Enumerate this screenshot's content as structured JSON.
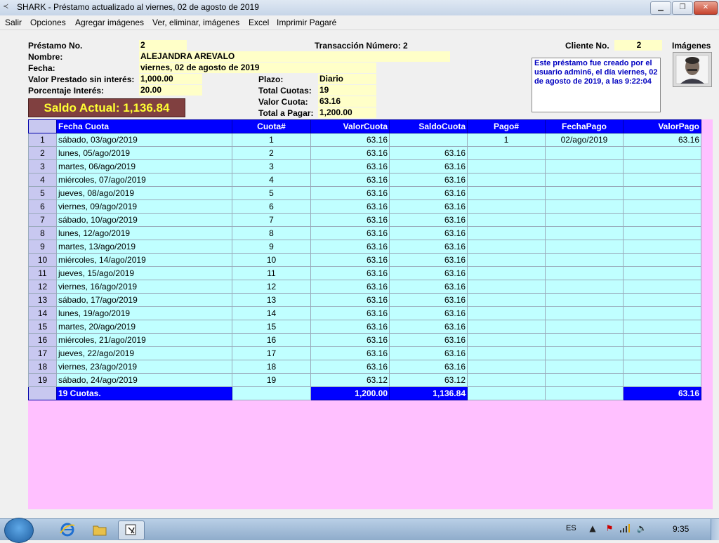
{
  "window": {
    "title": "SHARK - Préstamo actualizado al viernes, 02 de agosto de 2019",
    "min_glyph": "▁",
    "max_glyph": "❐",
    "close_glyph": "✕",
    "app_icon": "fish-icon"
  },
  "menu": [
    "Salir",
    "Opciones",
    "Agregar imágenes",
    "Ver, eliminar, imágenes",
    "Excel",
    "Imprimir Pagaré"
  ],
  "loan": {
    "prestamo_label": "Préstamo No.",
    "prestamo_value": "2",
    "transaccion_label": "Transacción Número: 2",
    "cliente_label": "Cliente No.",
    "cliente_value": "2",
    "imagenes_label": "Imágenes",
    "nombre_label": "Nombre:",
    "nombre_value": "ALEJANDRA AREVALO",
    "fecha_label": "Fecha:",
    "fecha_value": "viernes, 02 de agosto de 2019",
    "valor_label": "Valor Prestado sin interés:",
    "valor_value": "1,000.00",
    "porcentaje_label": "Porcentaje Interés:",
    "porcentaje_value": "20.00",
    "plazo_label": "Plazo:",
    "plazo_value": "Diario",
    "total_cuotas_label": "Total Cuotas:",
    "total_cuotas_value": "19",
    "valor_cuota_label": "Valor Cuota:",
    "valor_cuota_value": "63.16",
    "total_pagar_label": "Total a Pagar:",
    "total_pagar_value": "1,200.00",
    "saldo_actual": "Saldo Actual: 1,136.84",
    "note": "Este préstamo fue creado por el usuario admin6, el día viernes, 02 de agosto de 2019, a las 9:22:04"
  },
  "grid": {
    "headers": [
      "Fecha Cuota",
      "Cuota#",
      "ValorCuota",
      "SaldoCuota",
      "Pago#",
      "FechaPago",
      "ValorPago"
    ],
    "rows": [
      [
        "1",
        "sábado, 03/ago/2019",
        "1",
        "63.16",
        "",
        "1",
        "02/ago/2019",
        "63.16"
      ],
      [
        "2",
        "lunes, 05/ago/2019",
        "2",
        "63.16",
        "63.16",
        "",
        "",
        ""
      ],
      [
        "3",
        "martes, 06/ago/2019",
        "3",
        "63.16",
        "63.16",
        "",
        "",
        ""
      ],
      [
        "4",
        "miércoles, 07/ago/2019",
        "4",
        "63.16",
        "63.16",
        "",
        "",
        ""
      ],
      [
        "5",
        "jueves, 08/ago/2019",
        "5",
        "63.16",
        "63.16",
        "",
        "",
        ""
      ],
      [
        "6",
        "viernes, 09/ago/2019",
        "6",
        "63.16",
        "63.16",
        "",
        "",
        ""
      ],
      [
        "7",
        "sábado, 10/ago/2019",
        "7",
        "63.16",
        "63.16",
        "",
        "",
        ""
      ],
      [
        "8",
        "lunes, 12/ago/2019",
        "8",
        "63.16",
        "63.16",
        "",
        "",
        ""
      ],
      [
        "9",
        "martes, 13/ago/2019",
        "9",
        "63.16",
        "63.16",
        "",
        "",
        ""
      ],
      [
        "10",
        "miércoles, 14/ago/2019",
        "10",
        "63.16",
        "63.16",
        "",
        "",
        ""
      ],
      [
        "11",
        "jueves, 15/ago/2019",
        "11",
        "63.16",
        "63.16",
        "",
        "",
        ""
      ],
      [
        "12",
        "viernes, 16/ago/2019",
        "12",
        "63.16",
        "63.16",
        "",
        "",
        ""
      ],
      [
        "13",
        "sábado, 17/ago/2019",
        "13",
        "63.16",
        "63.16",
        "",
        "",
        ""
      ],
      [
        "14",
        "lunes, 19/ago/2019",
        "14",
        "63.16",
        "63.16",
        "",
        "",
        ""
      ],
      [
        "15",
        "martes, 20/ago/2019",
        "15",
        "63.16",
        "63.16",
        "",
        "",
        ""
      ],
      [
        "16",
        "miércoles, 21/ago/2019",
        "16",
        "63.16",
        "63.16",
        "",
        "",
        ""
      ],
      [
        "17",
        "jueves, 22/ago/2019",
        "17",
        "63.16",
        "63.16",
        "",
        "",
        ""
      ],
      [
        "18",
        "viernes, 23/ago/2019",
        "18",
        "63.16",
        "63.16",
        "",
        "",
        ""
      ],
      [
        "19",
        "sábado, 24/ago/2019",
        "19",
        "63.12",
        "63.12",
        "",
        "",
        ""
      ]
    ],
    "footer": {
      "cuotas": "19 Cuotas.",
      "valor_cuota": "1,200.00",
      "saldo_cuota": "1,136.84",
      "valor_pago": "63.16"
    }
  },
  "colors": {
    "grid_header": "#0000ff",
    "grid_cell": "#c0ffff",
    "grid_background": "#ffc0ff",
    "saldo_box": "#804040",
    "saldo_text": "#ffff33",
    "value_field": "#ffffc8",
    "note_text": "#0000c0"
  },
  "taskbar": {
    "language": "ES",
    "clock": "9:35",
    "start_icon": "windows-start-icon",
    "pinned": [
      "internet-explorer-icon",
      "file-explorer-icon",
      "shark-app-icon"
    ]
  }
}
